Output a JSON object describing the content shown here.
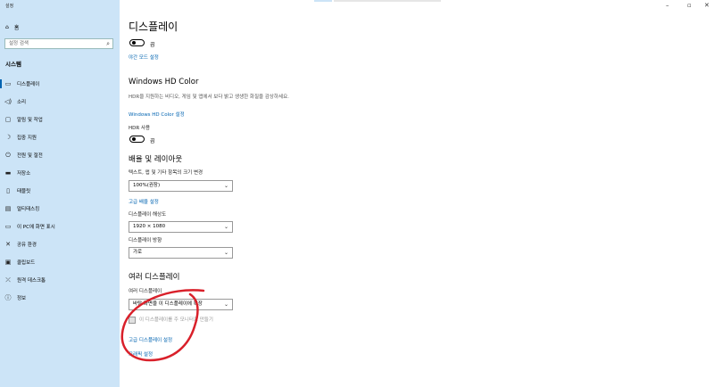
{
  "sidebar": {
    "app_title": "설정",
    "home_label": "홈",
    "search_placeholder": "설정 검색",
    "section_title": "시스템",
    "items": [
      {
        "label": "디스플레이",
        "icon": "monitor-icon"
      },
      {
        "label": "소리",
        "icon": "speaker-icon"
      },
      {
        "label": "알림 및 작업",
        "icon": "notification-icon"
      },
      {
        "label": "집중 지원",
        "icon": "moon-icon"
      },
      {
        "label": "전원 및 절전",
        "icon": "power-icon"
      },
      {
        "label": "저장소",
        "icon": "storage-icon"
      },
      {
        "label": "태블릿",
        "icon": "tablet-icon"
      },
      {
        "label": "멀티태스킹",
        "icon": "multitask-icon"
      },
      {
        "label": "이 PC에 화면 표시",
        "icon": "project-icon"
      },
      {
        "label": "공유 환경",
        "icon": "share-icon"
      },
      {
        "label": "클립보드",
        "icon": "clipboard-icon"
      },
      {
        "label": "원격 데스크톱",
        "icon": "remote-icon"
      },
      {
        "label": "정보",
        "icon": "info-icon"
      }
    ]
  },
  "window_controls": {
    "minimize": "–",
    "maximize": "▫",
    "close": "✕"
  },
  "main": {
    "page_title": "디스플레이",
    "night_light_toggle_label": "끔",
    "night_light_link": "야간 모드 설정",
    "hdr_section_title": "Windows HD Color",
    "hdr_description": "HDR을 지원하는 비디오, 게임 및 앱에서 보다 밝고 생생한 화질을 감상하세요.",
    "hdr_link": "Windows HD Color 설정",
    "hdr_use_label": "HDR 사용",
    "hdr_toggle_label": "끔",
    "layout_title": "배율 및 레이아웃",
    "scale_label": "텍스트, 앱 및 기타 항목의 크기 변경",
    "scale_value": "100%(권장)",
    "advanced_scale_link": "고급 배율 설정",
    "resolution_label": "디스플레이 해상도",
    "resolution_value": "1920 × 1080",
    "orientation_label": "디스플레이 방향",
    "orientation_value": "가로",
    "multi_title": "여러 디스플레이",
    "multi_label": "여러 디스플레이",
    "multi_value": "바탕 화면을 이 디스플레이에 확장",
    "main_display_checkbox": "이 디스플레이를 주 모니터로 만들기",
    "advanced_display_link": "고급 디스플레이 설정",
    "graphics_link": "그래픽 설정"
  },
  "colors": {
    "sidebar_bg": "#cce4f7",
    "accent": "#0063b1",
    "annotation": "#d9202a"
  }
}
